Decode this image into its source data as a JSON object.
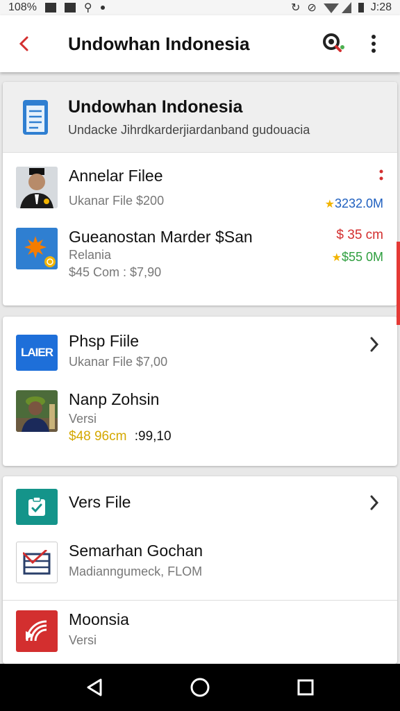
{
  "status_bar": {
    "battery": "108%",
    "time": "J:28"
  },
  "app_bar": {
    "title": "Undowhan Indonesia"
  },
  "section1": {
    "title": "Undowhan Indonesia",
    "subtitle": "Undacke Jihrdkarderjiardanband gudouacia",
    "items": [
      {
        "title": "Annelar Filee",
        "sub": "Ukanar File $200",
        "right_value": "3232.0M"
      },
      {
        "title": "Gueanostan Marder $San",
        "sub": "Relania",
        "sub2": "$45 Com  : $7,90",
        "right_top": "$ 35 cm",
        "right_value": "$55 0M"
      }
    ]
  },
  "section2": {
    "items": [
      {
        "title": "Phsp Fiile",
        "sub": "Ukanar File $7,00",
        "badge": "LAIER"
      },
      {
        "title": "Nanp Zohsin",
        "sub": "Versi",
        "price_yellow": "$48 96cm",
        "price_black": ":99,10"
      }
    ]
  },
  "section3": {
    "items": [
      {
        "title": "Vers File"
      },
      {
        "title": "Semarhan Gochan",
        "sub": "Madianngumeck, FLOM"
      },
      {
        "title": "Moonsia",
        "sub": "Versi"
      }
    ]
  },
  "colors": {
    "accent_red": "#d32f2f",
    "star_yellow": "#f2b400",
    "blue": "#1e5fbf",
    "green": "#2e9e3e",
    "teal": "#14948a"
  },
  "icons": {
    "back": "back-arrow-icon",
    "search": "search-icon",
    "more": "more-vert-icon",
    "file": "document-icon",
    "chevron": "chevron-right-icon",
    "nav_back": "nav-back-icon",
    "nav_home": "nav-home-icon",
    "nav_recent": "nav-recent-icon"
  }
}
